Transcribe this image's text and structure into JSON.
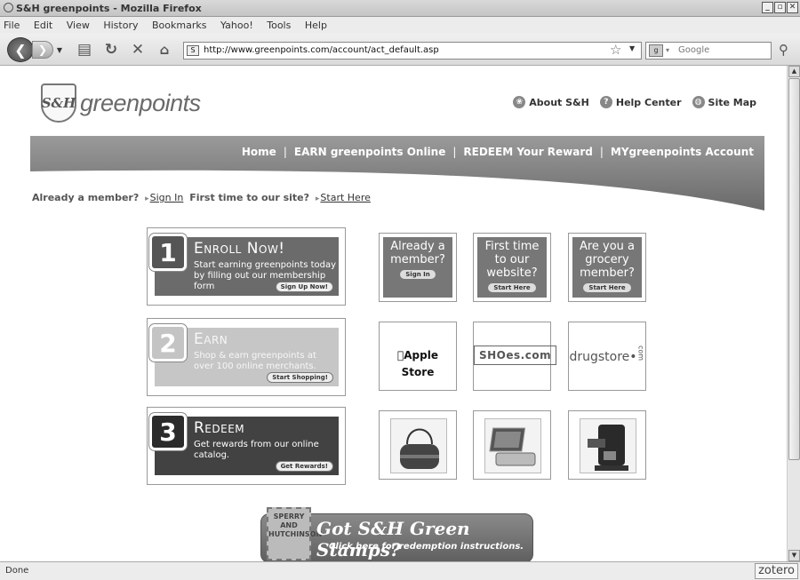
{
  "browser": {
    "window_title": "S&H greenpoints - Mozilla Firefox",
    "menu": [
      "File",
      "Edit",
      "View",
      "History",
      "Bookmarks",
      "Yahoo!",
      "Tools",
      "Help"
    ],
    "url": "http://www.greenpoints.com/account/act_default.asp",
    "search_placeholder": "Google",
    "status": "Done",
    "zotero": "zotero"
  },
  "site": {
    "logo_mark": "S&H",
    "logo_text": "greenpoints",
    "toplinks": [
      "About S&H",
      "Help Center",
      "Site Map"
    ],
    "nav": [
      "Home",
      "EARN greenpoints Online",
      "REDEEM Your Reward",
      "MYgreenpoints Account"
    ],
    "member": {
      "q1": "Already a member?",
      "sign_in": "Sign In",
      "q2": "First time to our site?",
      "start": "Start Here"
    },
    "steps": [
      {
        "num": "1",
        "title": "Enroll Now!",
        "desc": "Start earning greenpoints today by filling out our membership form",
        "cta": "Sign Up Now!"
      },
      {
        "num": "2",
        "title": "Earn",
        "desc": "Shop & earn greenpoints at over 100 online merchants.",
        "cta": "Start Shopping!"
      },
      {
        "num": "3",
        "title": "Redeem",
        "desc": "Get rewards from our online catalog.",
        "cta": "Get Rewards!"
      }
    ],
    "tiles": [
      {
        "text": "Already a member?",
        "pill": "Sign In"
      },
      {
        "text": "First time to our website?",
        "pill": "Start Here"
      },
      {
        "text": "Are you a grocery member?",
        "pill": "Start Here"
      }
    ],
    "merchants": [
      "Apple Store",
      "SHOes.com",
      "drugstore"
    ],
    "stamps": {
      "badge": "SPERRY AND HUTCHINSON",
      "headline": "Got S&H Green Stamps?",
      "sub": "Click here for redemption instructions."
    }
  }
}
